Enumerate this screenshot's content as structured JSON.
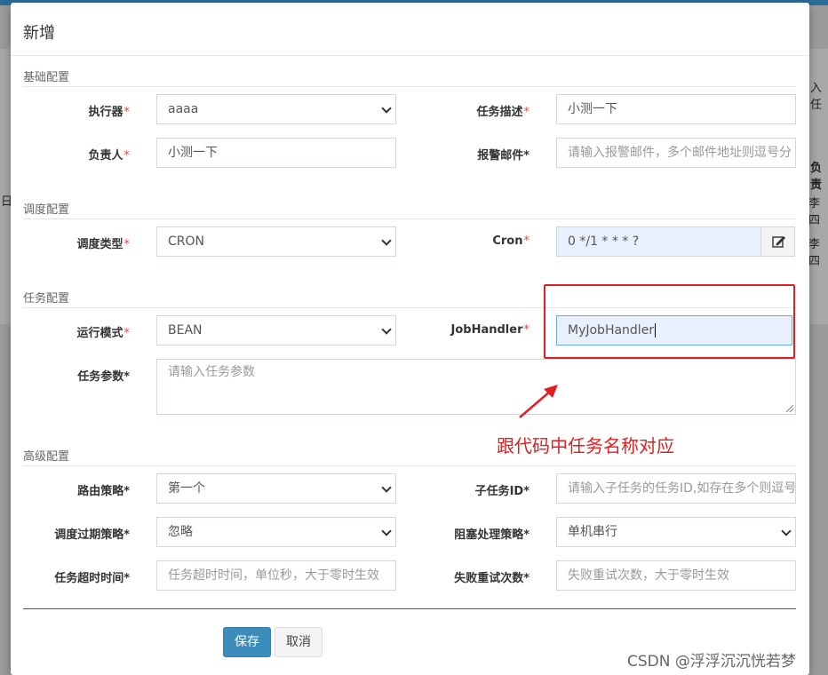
{
  "background": {
    "right_cut_1": "入任",
    "right_cut_2": "负责",
    "right_cut_3": "李四",
    "right_cut_4": "李四",
    "left_cut": "日"
  },
  "modal": {
    "title": "新增",
    "sections": {
      "basic": "基础配置",
      "schedule": "调度配置",
      "task": "任务配置",
      "advanced": "高级配置"
    },
    "fields": {
      "executor": {
        "label": "执行器",
        "required": "*",
        "value": "aaaa"
      },
      "job_desc": {
        "label": "任务描述",
        "required": "*",
        "value": "小测一下"
      },
      "author": {
        "label": "负责人",
        "required": "*",
        "value": "小测一下"
      },
      "alarm_email": {
        "label": "报警邮件*",
        "placeholder": "请输入报警邮件，多个邮件地址则逗号分"
      },
      "schedule_type": {
        "label": "调度类型",
        "required": "*",
        "value": "CRON"
      },
      "cron": {
        "label": "Cron",
        "required": "*",
        "value": "0 */1 * * * ?"
      },
      "run_mode": {
        "label": "运行模式",
        "required": "*",
        "value": "BEAN"
      },
      "job_handler": {
        "label": "JobHandler",
        "required": "*",
        "value": "MyJobHandler"
      },
      "job_param": {
        "label": "任务参数*",
        "placeholder": "请输入任务参数"
      },
      "route_strategy": {
        "label": "路由策略*",
        "value": "第一个"
      },
      "child_job": {
        "label": "子任务ID*",
        "placeholder": "请输入子任务的任务ID,如存在多个则逗号分隔"
      },
      "misfire_strategy": {
        "label": "调度过期策略*",
        "value": "忽略"
      },
      "block_strategy": {
        "label": "阻塞处理策略*",
        "value": "单机串行"
      },
      "timeout": {
        "label": "任务超时时间*",
        "placeholder": "任务超时时间，单位秒，大于零时生效"
      },
      "fail_retry": {
        "label": "失败重试次数*",
        "placeholder": "失败重试次数，大于零时生效"
      }
    },
    "buttons": {
      "save": "保存",
      "cancel": "取消"
    }
  },
  "annotation": {
    "text": "跟代码中任务名称对应",
    "color": "#e02020"
  },
  "watermark": "CSDN @浮浮沉沉恍若梦",
  "colors": {
    "primary": "#3c8dbc",
    "required": "#dd4b39",
    "autofill": "#e8f0fe"
  },
  "icons": {
    "cron_button": "edit-icon"
  }
}
